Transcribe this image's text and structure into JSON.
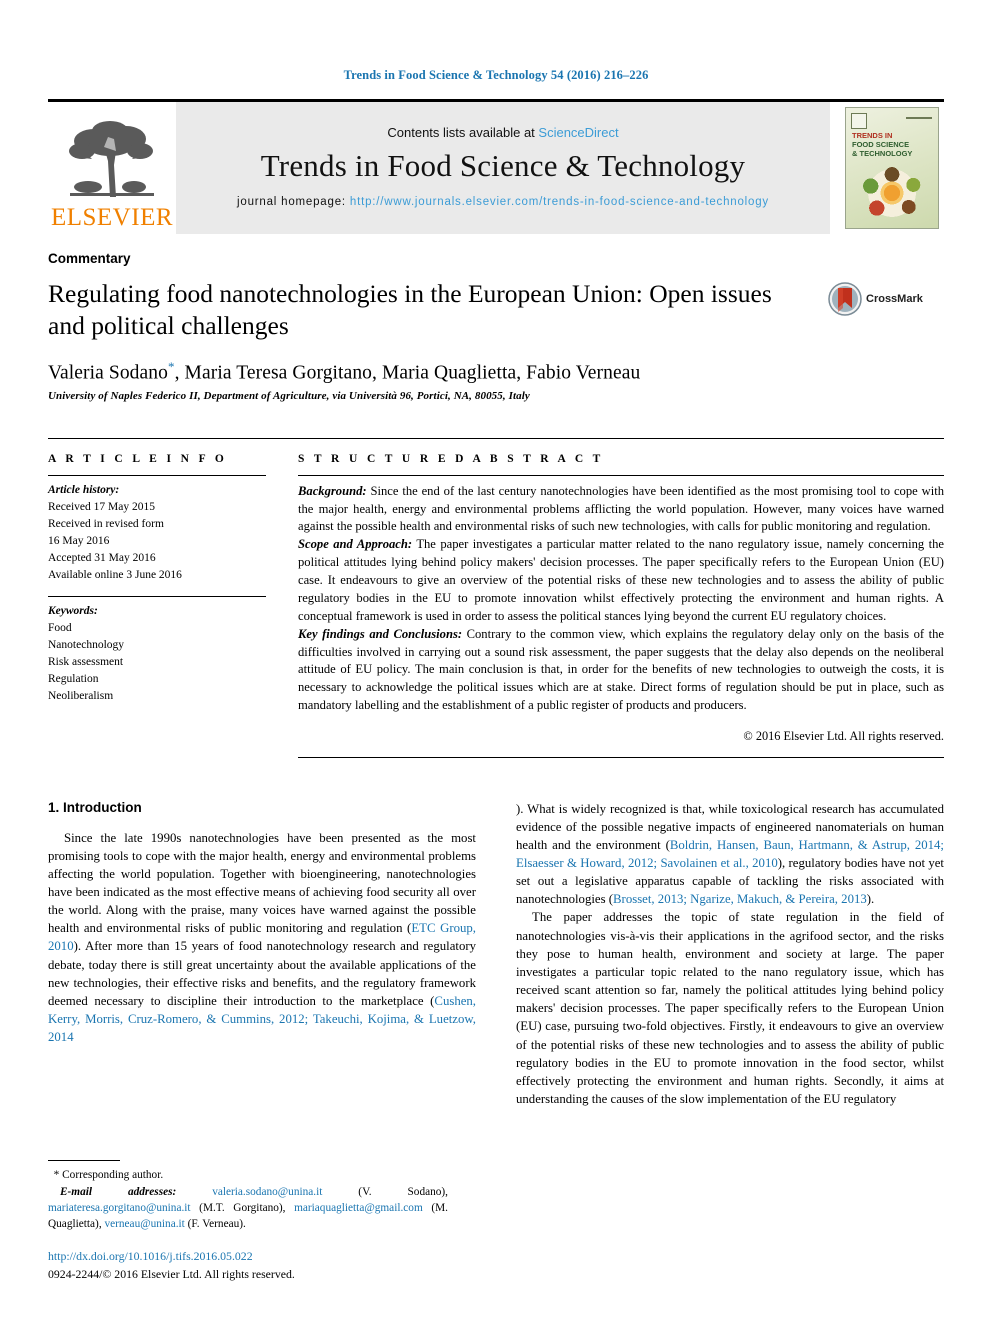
{
  "running_head": "Trends in Food Science & Technology 54 (2016) 216–226",
  "colors": {
    "link_blue": "#1a75b0",
    "sciencedirect_blue": "#3c9cd6",
    "elsevier_orange": "#f08000"
  },
  "masthead": {
    "publisher_logo_text": "ELSEVIER",
    "contents_prefix": "Contents lists available at ",
    "contents_link": "ScienceDirect",
    "journal_title": "Trends in Food Science & Technology",
    "homepage_prefix": "journal homepage: ",
    "homepage_url": "http://www.journals.elsevier.com/trends-in-food-science-and-technology",
    "cover": {
      "line1": "TRENDS IN",
      "line2": "FOOD SCIENCE",
      "line3": "& TECHNOLOGY"
    }
  },
  "article": {
    "type": "Commentary",
    "title": "Regulating food nanotechnologies in the European Union: Open issues and political challenges",
    "crossmark_label": "CrossMark",
    "authors_text": "Valeria Sodano",
    "authors_rest": ", Maria Teresa Gorgitano, Maria Quaglietta, Fabio Verneau",
    "corresponding_marker": "*",
    "affiliation": "University of Naples Federico II, Department of Agriculture, via Università 96, Portici, NA, 80055, Italy"
  },
  "article_info": {
    "label": "A R T I C L E  I N F O",
    "history_heading": "Article history:",
    "history": [
      "Received 17 May 2015",
      "Received in revised form",
      "16 May 2016",
      "Accepted 31 May 2016",
      "Available online 3 June 2016"
    ],
    "keywords_heading": "Keywords:",
    "keywords": [
      "Food",
      "Nanotechnology",
      "Risk assessment",
      "Regulation",
      "Neoliberalism"
    ]
  },
  "abstract": {
    "label": "S T R U C T U R E D  A B S T R A C T",
    "sections": [
      {
        "lead": "Background:",
        "text": " Since the end of the last century nanotechnologies have been identified as the most promising tool to cope with the major health, energy and environmental problems afflicting the world population. However, many voices have warned against the possible health and environmental risks of such new technologies, with calls for public monitoring and regulation."
      },
      {
        "lead": "Scope and Approach:",
        "text": " The paper investigates a particular matter related to the nano regulatory issue, namely concerning the political attitudes lying behind policy makers' decision processes. The paper specifically refers to the European Union (EU) case. It endeavours to give an overview of the potential risks of these new technologies and to assess the ability of public regulatory bodies in the EU to promote innovation whilst effectively protecting the environment and human rights. A conceptual framework is used in order to assess the political stances lying beyond the current EU regulatory choices."
      },
      {
        "lead": "Key findings and Conclusions:",
        "text": "  Contrary to the common view, which explains the regulatory delay only on the basis of the difficulties involved in carrying out a sound risk assessment, the paper suggests that the delay also depends on the neoliberal attitude of EU policy. The main conclusion is that, in order for the benefits of new technologies to outweigh the costs, it is necessary to acknowledge the political issues which are at stake. Direct forms of regulation should be put in place, such as mandatory labelling and the establishment of a public register of products and producers."
      }
    ],
    "copyright": "© 2016 Elsevier Ltd. All rights reserved."
  },
  "body": {
    "section_heading": "1. Introduction",
    "left_paragraph_1_a": "Since the late 1990s nanotechnologies have been presented as the most promising tools to cope with the major health, energy and environmental problems affecting the world population. Together with bioengineering, nanotechnologies have been indicated as the most effective means of achieving food security all over the world. Along with the praise, many voices have warned against the possible health and environmental risks of public monitoring and regulation (",
    "cite_etc": "ETC Group, 2010",
    "left_paragraph_1_b": "). After more than 15 years of food nanotechnology research and regulatory debate, today there is still great uncertainty about the available applications of the new technologies, their effective risks and benefits, and the regulatory framework deemed necessary to discipline their introduction to the marketplace (",
    "cite_cushen": "Cushen, Kerry, Morris, Cruz-Romero, & Cummins, 2012; Takeuchi, Kojima, & Luetzow, 2014",
    "right_paragraph_1_c": "). What is widely recognized is that, while toxicological research has accumulated evidence of the possible negative impacts of engineered nanomaterials on human health and the environment (",
    "cite_boldrin": "Boldrin, Hansen, Baun, Hartmann, & Astrup, 2014; Elsaesser & Howard, 2012; Savolainen et al., 2010",
    "right_paragraph_1_d": "), regulatory bodies have not yet set out a legislative apparatus capable of tackling the risks associated with nanotechnologies (",
    "cite_brosset": "Brosset, 2013; Ngarize, Makuch, & Pereira, 2013",
    "right_paragraph_1_e": ").",
    "right_paragraph_2": "The paper addresses the topic of state regulation in the field of nanotechnologies vis-à-vis their applications in the agrifood sector, and the risks they pose to human health, environment and society at large. The paper investigates a particular topic related to the nano regulatory issue, which has received scant attention so far, namely the political attitudes lying behind policy makers' decision processes. The paper specifically refers to the European Union (EU) case, pursuing two-fold objectives. Firstly, it endeavours to give an overview of the potential risks of these new technologies and to assess the ability of public regulatory bodies in the EU to promote innovation in the food sector, whilst effectively protecting the environment and human rights. Secondly, it aims at understanding the causes of the slow implementation of the EU regulatory"
  },
  "footer": {
    "corresponding_author": "Corresponding author.",
    "email_label": "E-mail addresses:",
    "emails": [
      {
        "address": "valeria.sodano@unina.it",
        "name": " (V. Sodano), "
      },
      {
        "address": "mariateresa.gorgitano@unina.it",
        "name": " (M.T. Gorgitano), "
      },
      {
        "address": "mariaquaglietta@gmail.com",
        "name": " (M. Quaglietta), "
      },
      {
        "address": "verneau@unina.it",
        "name": " (F. Verneau)."
      }
    ],
    "doi": "http://dx.doi.org/10.1016/j.tifs.2016.05.022",
    "issn_copyright": "0924-2244/© 2016 Elsevier Ltd. All rights reserved."
  }
}
